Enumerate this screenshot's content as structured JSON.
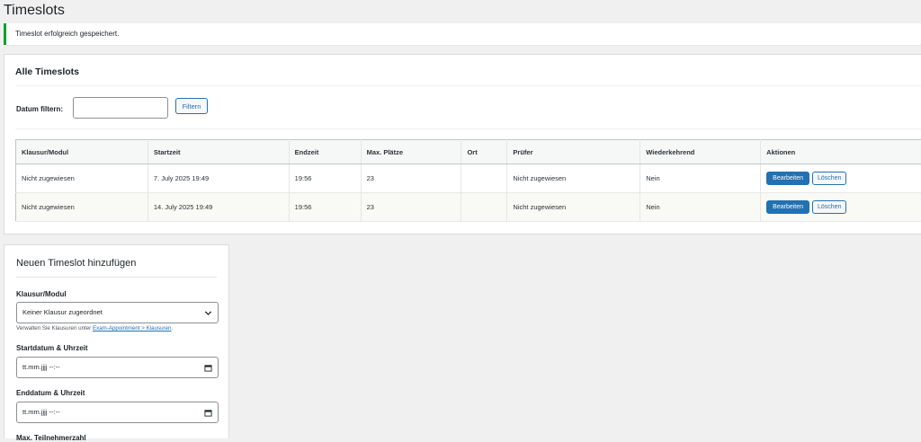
{
  "page": {
    "title": "Timeslots"
  },
  "notice": {
    "text": "Timeslot erfolgreich gespeichert."
  },
  "list": {
    "title": "Alle Timeslots",
    "filter": {
      "label": "Datum filtern:",
      "value": "",
      "button": "Filtern"
    },
    "columns": [
      "Klausur/Modul",
      "Startzeit",
      "Endzeit",
      "Max. Plätze",
      "Ort",
      "Prüfer",
      "Wiederkehrend",
      "Aktionen"
    ],
    "rows": [
      {
        "modul": "Nicht zugewiesen",
        "start": "7. July 2025 19:49",
        "end": "19:56",
        "max": "23",
        "ort": "",
        "pruefer": "Nicht zugewiesen",
        "wiederkehrend": "Nein",
        "edit": "Bearbeiten",
        "delete": "Löschen"
      },
      {
        "modul": "Nicht zugewiesen",
        "start": "14. July 2025 19:49",
        "end": "19:56",
        "max": "23",
        "ort": "",
        "pruefer": "Nicht zugewiesen",
        "wiederkehrend": "Nein",
        "edit": "Bearbeiten",
        "delete": "Löschen"
      }
    ]
  },
  "form": {
    "title": "Neuen Timeslot hinzufügen",
    "modul": {
      "label": "Klausur/Modul",
      "selected": "Keiner Klausur zugeordnet"
    },
    "hint": {
      "prefix": "Verwalten Sie Klausuren unter ",
      "link": "Exam-Appointment > Klausuren",
      "suffix": "."
    },
    "start": {
      "label": "Startdatum & Uhrzeit",
      "placeholder": "tt.mm.jjjj --:--"
    },
    "end": {
      "label": "Enddatum & Uhrzeit",
      "placeholder": "tt.mm.jjjj --:--"
    },
    "max": {
      "label": "Max. Teilnehmerzahl"
    }
  },
  "icons": {
    "chevron": "chevron-down-icon",
    "calendar": "calendar-icon"
  },
  "colors": {
    "primary": "#2271b1",
    "success": "#00a32a"
  }
}
